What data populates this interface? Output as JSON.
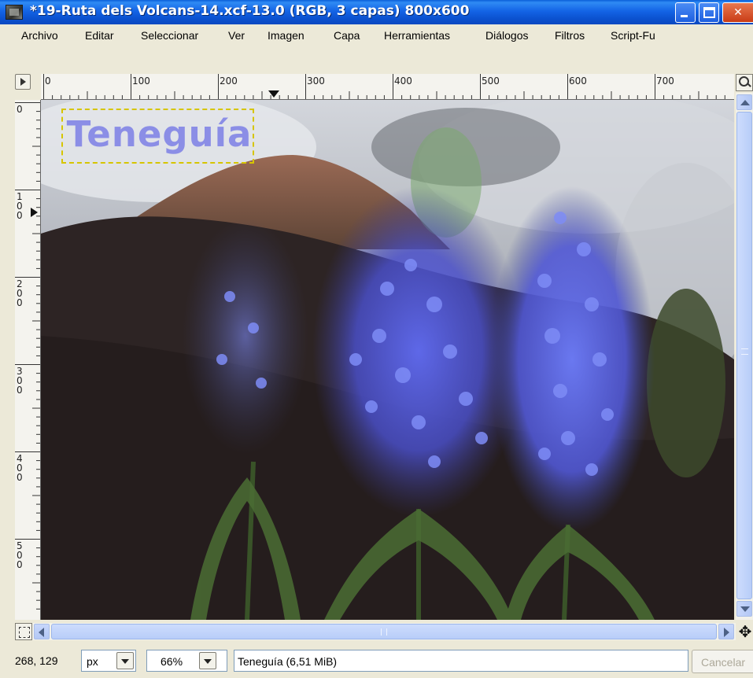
{
  "window": {
    "title": "*19-Ruta dels Volcans-14.xcf-13.0 (RGB, 3 capas) 800x600",
    "controls": {
      "minimize": "minimize",
      "maximize": "maximize",
      "close": "✕"
    }
  },
  "menu": {
    "items": [
      "Archivo",
      "Editar",
      "Seleccionar",
      "Ver",
      "Imagen",
      "Capa",
      "Herramientas",
      "Diálogos",
      "Filtros",
      "Script-Fu"
    ]
  },
  "rulers": {
    "horizontal_labels": [
      "0",
      "100",
      "200",
      "300",
      "400",
      "500",
      "600",
      "700"
    ],
    "vertical_labels": [
      "0",
      "100",
      "200",
      "300",
      "400",
      "500"
    ]
  },
  "canvas": {
    "text_layer": "Teneguía"
  },
  "statusbar": {
    "coords": "268, 129",
    "unit": "px",
    "zoom": "66%",
    "message": "Teneguía (6,51 MiB)",
    "cancel": "Cancelar"
  },
  "colors": {
    "titlebar": "#1464e6",
    "text_layer": "#8b8ee6",
    "selection_border": "#d6c500"
  }
}
